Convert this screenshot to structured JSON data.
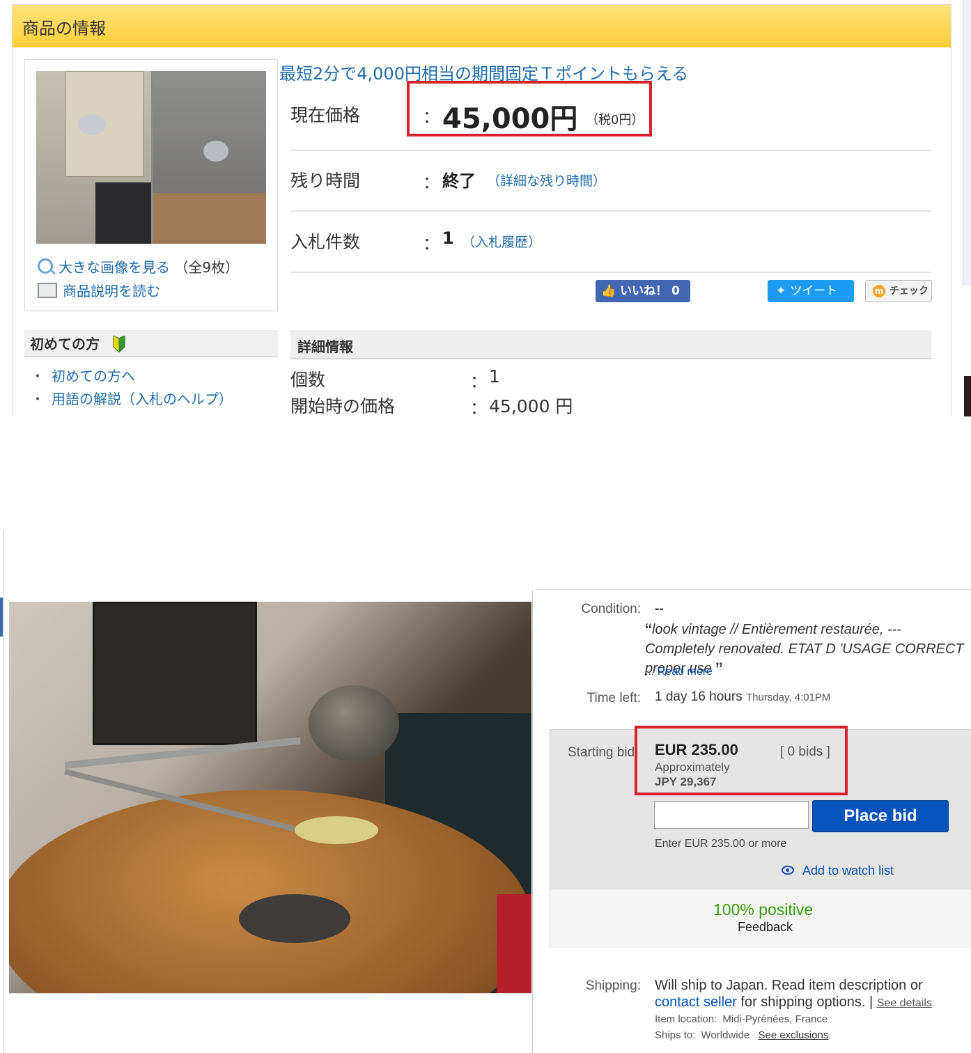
{
  "yahoo": {
    "header_title": "商品の情報",
    "tpoint_banner": "最短2分で4,000円相当の期間固定Ｔポイントもらえる",
    "price": {
      "label": "現在価格",
      "colon": "：",
      "value": "45,000円",
      "tax": "（税0円）"
    },
    "time_left": {
      "label": "残り時間",
      "colon": "：",
      "value": "終了",
      "link": "（詳細な残り時間）"
    },
    "bid_count": {
      "label": "入札件数",
      "colon": "：",
      "value": "1",
      "link": "（入札履歴）"
    },
    "image_links": {
      "big_image": "大きな画像を見る",
      "count": "（全9枚）",
      "read_description": "商品説明を読む"
    },
    "social": {
      "like": "いいね！ 0",
      "tweet": "ツイート",
      "check": "チェック"
    },
    "first_time": {
      "title": "初めての方",
      "links": [
        "初めての方へ",
        "用語の解説（入札のヘルプ）"
      ],
      "bullet": "・"
    },
    "details": {
      "title": "詳細情報",
      "rows": [
        {
          "label": "個数",
          "colon": "：",
          "value": "1"
        },
        {
          "label": "開始時の価格",
          "colon": "：",
          "value": "45,000 円"
        }
      ]
    },
    "colors": {
      "accent_red": "#d8222c",
      "link_blue": "#1f6ba8",
      "header_yellow": "#ffd94f"
    }
  },
  "ebay": {
    "condition": {
      "label": "Condition:",
      "value": "--",
      "quote": "look vintage // Entièrement restaurée, --- Completely renovated. ETAT D 'USAGE CORRECT proper use",
      "open_quote": "“",
      "close_quote": "”",
      "ellipsis": "...",
      "read_more": "Read more"
    },
    "time_left": {
      "label": "Time left:",
      "value": "1 day 16 hours",
      "sub": "Thursday, 4:01PM"
    },
    "starting_bid": {
      "label": "Starting bid:",
      "amount": "EUR 235.00",
      "approx": "Approximately",
      "jpy": "JPY 29,367",
      "bids": "[ 0 bids ]"
    },
    "place_bid": "Place bid",
    "enter_hint": "Enter EUR 235.00 or more",
    "watch": "Add to watch list",
    "feedback": {
      "percent": "100% positive",
      "label": "Feedback"
    },
    "shipping": {
      "label": "Shipping:",
      "text_1": "Will ship to Japan. Read item description or",
      "contact_seller": "contact seller",
      "text_2": "for shipping options.",
      "separator": "|",
      "see_details": "See details"
    },
    "item_location": {
      "label": "Item location:",
      "value": "Midi-Pyrénées, France"
    },
    "ships_to": {
      "label": "Ships to:",
      "value": "Worldwide",
      "exclusions": "See exclusions"
    },
    "colors": {
      "bid_blue": "#0654ba",
      "positive_green": "#3a9a0a",
      "accent_red": "#d8222c"
    }
  }
}
